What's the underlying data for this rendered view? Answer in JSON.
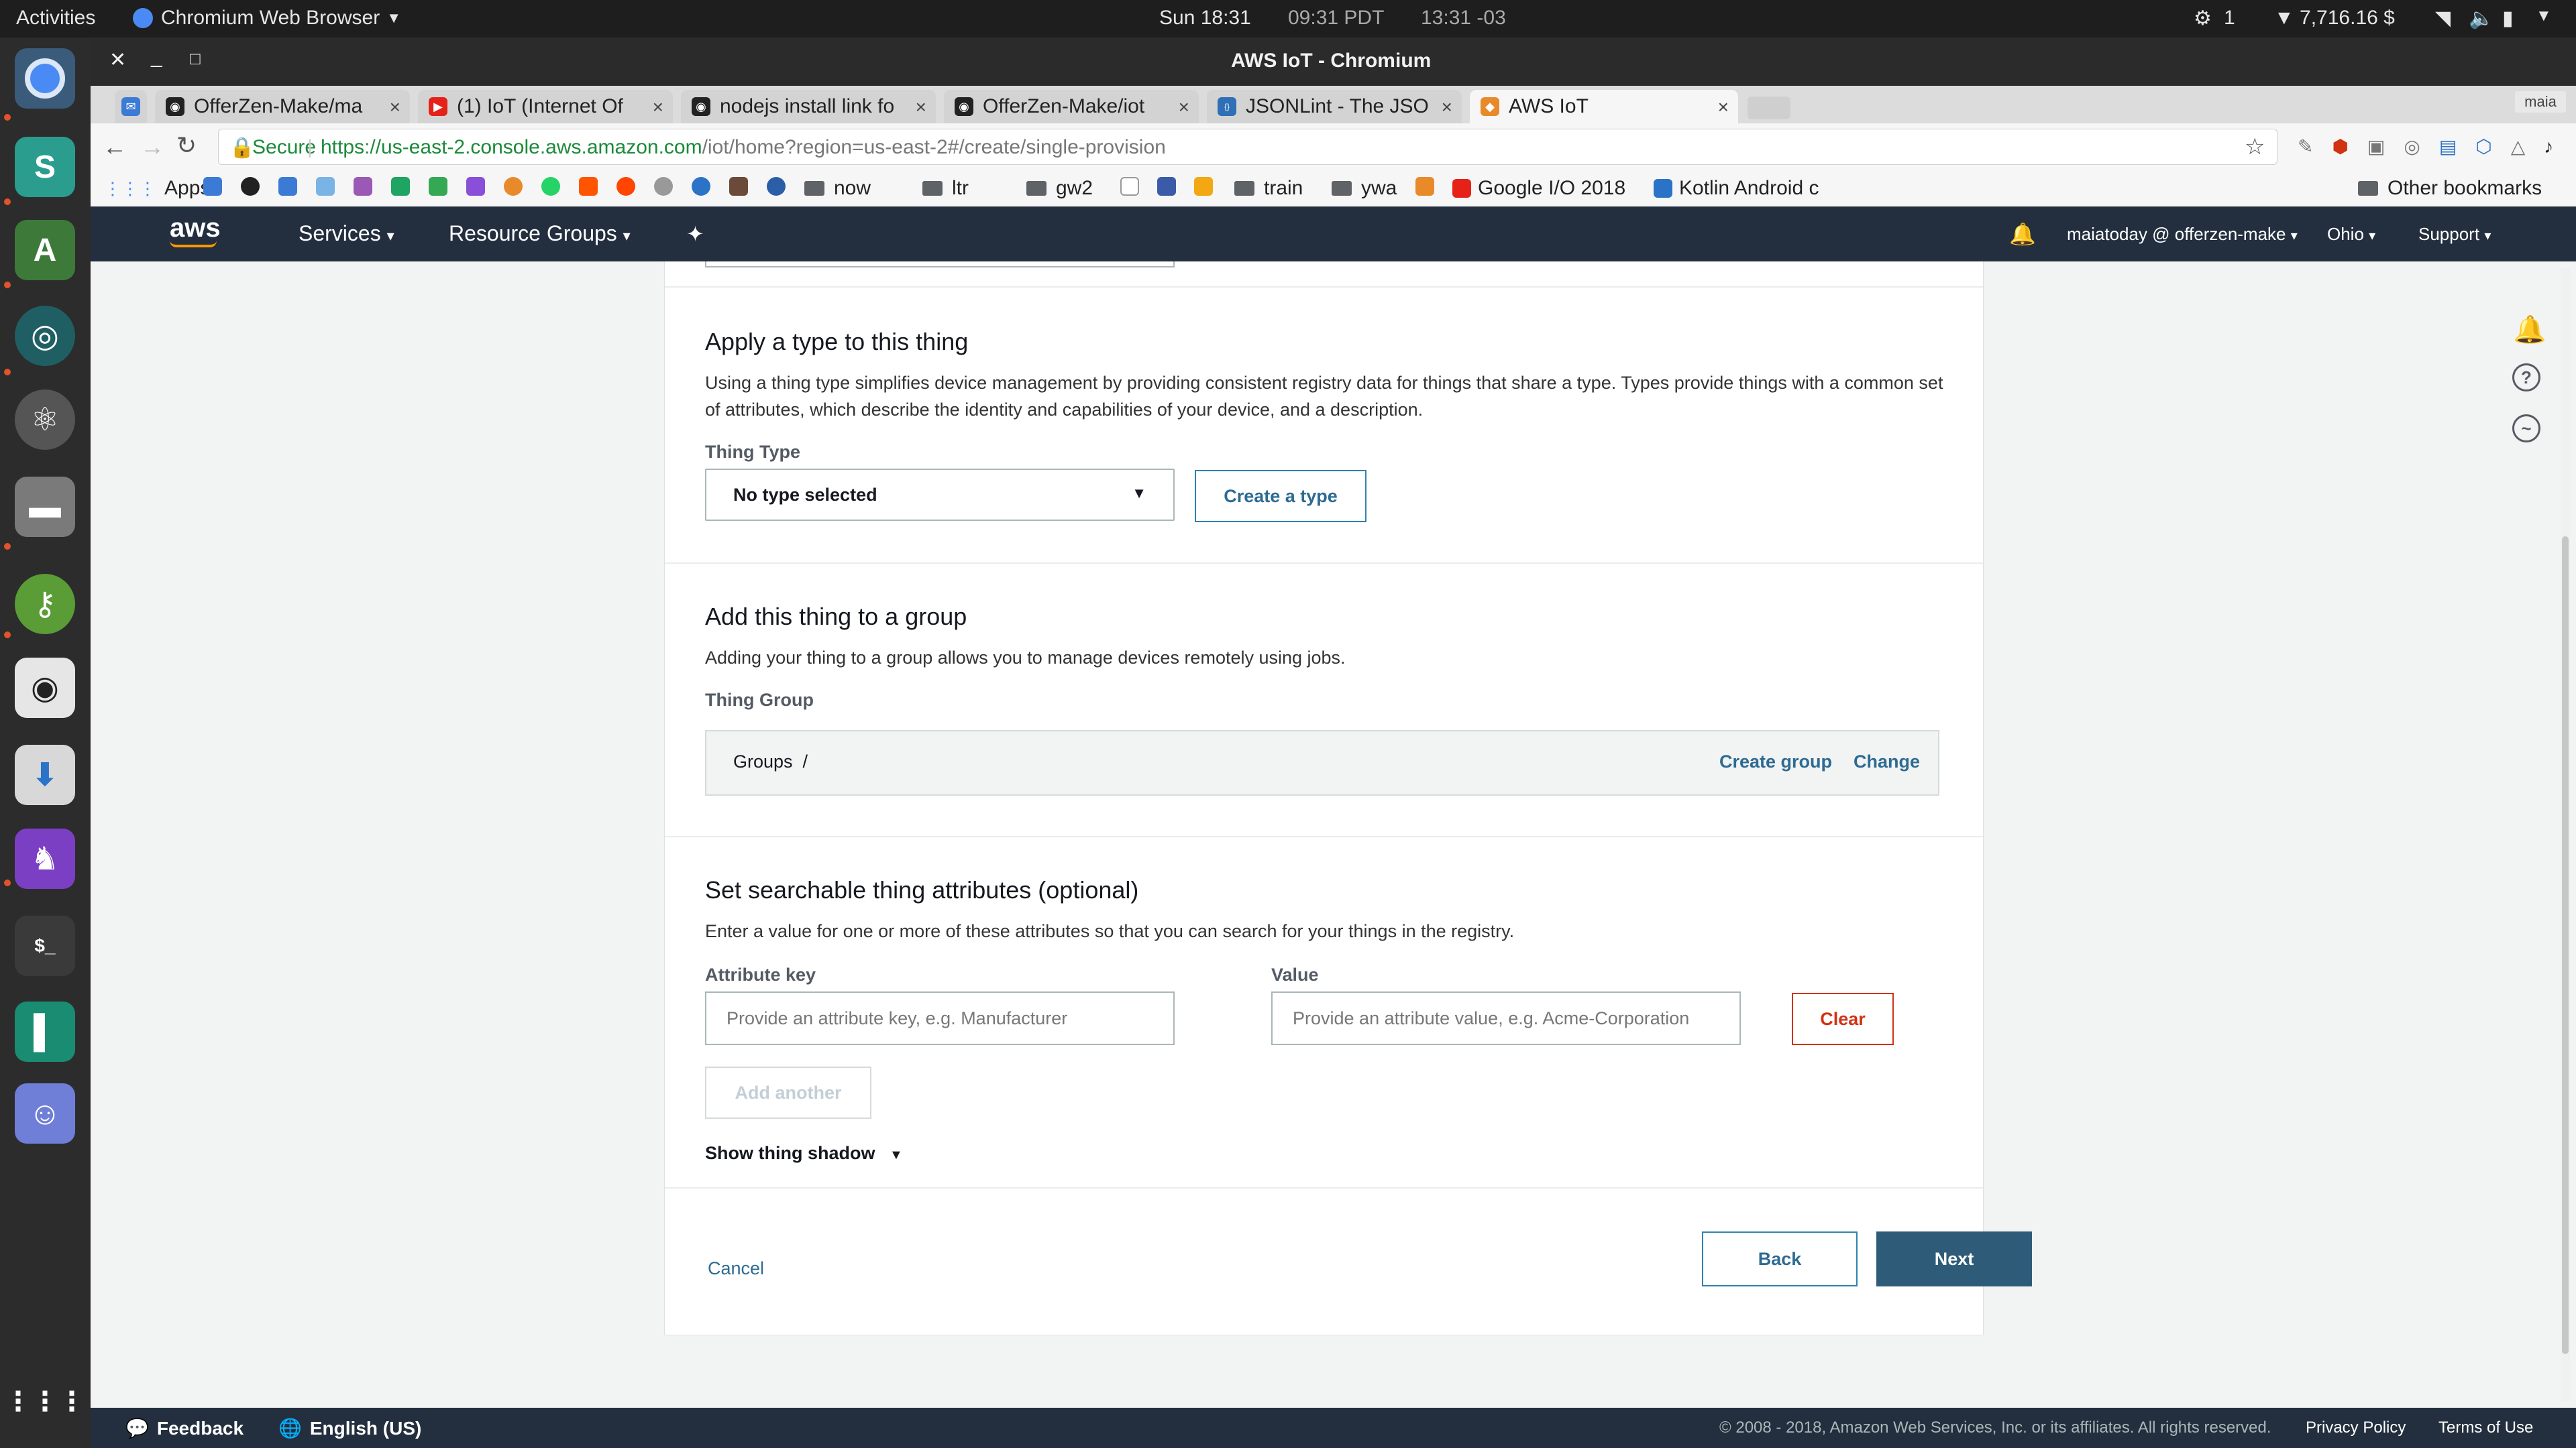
{
  "os": {
    "activities": "Activities",
    "app_menu": "Chromium Web Browser",
    "clock": "Sun 18:31",
    "clock_pdt": "09:31 PDT",
    "clock_other": "13:31 -03",
    "indicator_count": "1",
    "wallet": "7,716.16 $"
  },
  "window": {
    "title": "AWS IoT - Chromium"
  },
  "tabs": [
    {
      "label": "OfferZen-Make/ma"
    },
    {
      "label": "(1) IoT (Internet Of"
    },
    {
      "label": "nodejs install link fo"
    },
    {
      "label": "OfferZen-Make/iot"
    },
    {
      "label": "JSONLint - The JSO"
    },
    {
      "label": "AWS IoT"
    }
  ],
  "profile": "maia",
  "address": {
    "secure": "Secure",
    "url_host": "https://us-east-2.console.aws.amazon.com",
    "url_path": "/iot/home?region=us-east-2#/create/single-provision"
  },
  "bookmarks": {
    "apps": "Apps",
    "now": "now",
    "ltr": "ltr",
    "gw2": "gw2",
    "train": "train",
    "ywa": "ywa",
    "google_io": "Google I/O 2018",
    "kotlin": "Kotlin Android c",
    "other": "Other bookmarks"
  },
  "aws_nav": {
    "logo": "aws",
    "services": "Services",
    "resource_groups": "Resource Groups",
    "account": "maiatoday @ offerzen-make",
    "region": "Ohio",
    "support": "Support"
  },
  "type_section": {
    "title": "Apply a type to this thing",
    "description": "Using a thing type simplifies device management by providing consistent registry data for things that share a type. Types provide things with a common set of attributes, which describe the identity and capabilities of your device, and a description.",
    "label": "Thing Type",
    "select_value": "No type selected",
    "create_button": "Create a type"
  },
  "group_section": {
    "title": "Add this thing to a group",
    "description": "Adding your thing to a group allows you to manage devices remotely using jobs.",
    "label": "Thing Group",
    "path": "Groups  /",
    "create_link": "Create group",
    "change_link": "Change"
  },
  "attr_section": {
    "title": "Set searchable thing attributes (optional)",
    "description": "Enter a value for one or more of these attributes so that you can search for your things in the registry.",
    "key_label": "Attribute key",
    "value_label": "Value",
    "key_placeholder": "Provide an attribute key, e.g. Manufacturer",
    "value_placeholder": "Provide an attribute value, e.g. Acme-Corporation",
    "clear_button": "Clear",
    "add_another": "Add another",
    "show_shadow": "Show thing shadow"
  },
  "actions": {
    "cancel": "Cancel",
    "back": "Back",
    "next": "Next"
  },
  "footer": {
    "feedback": "Feedback",
    "language": "English (US)",
    "copyright": "© 2008 - 2018, Amazon Web Services, Inc. or its affiliates. All rights reserved.",
    "privacy": "Privacy Policy",
    "terms": "Terms of Use"
  },
  "colors": {
    "aws_nav": "#232f3e",
    "primary_button": "#2e5c78",
    "link": "#2d6b92",
    "danger": "#d13212"
  }
}
